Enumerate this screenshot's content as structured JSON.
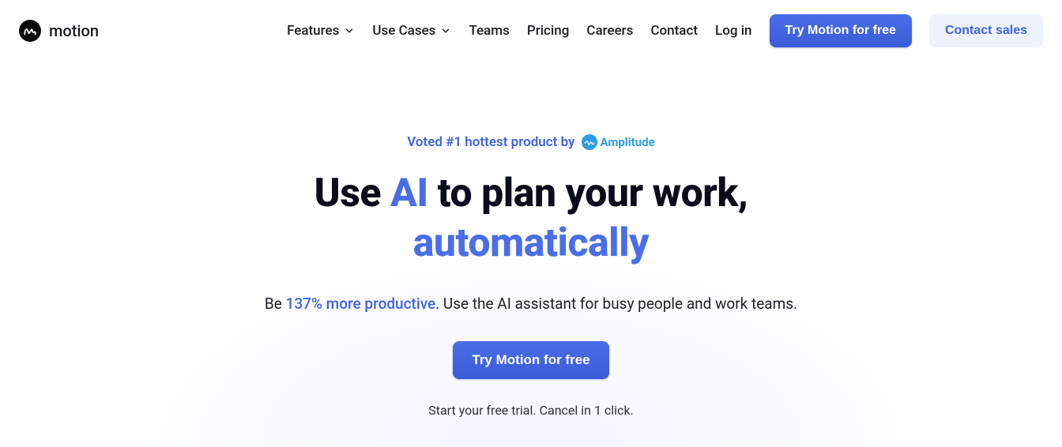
{
  "brand": {
    "name": "motion"
  },
  "nav": {
    "features": "Features",
    "use_cases": "Use Cases",
    "teams": "Teams",
    "pricing": "Pricing",
    "careers": "Careers",
    "contact": "Contact",
    "login": "Log in"
  },
  "cta": {
    "try_free": "Try Motion for free",
    "contact_sales": "Contact sales"
  },
  "hero": {
    "tagline": "Voted #1 hottest product by",
    "amplitude": "Amplitude",
    "headline_pre": "Use ",
    "headline_ai": "AI",
    "headline_mid": " to plan your work,",
    "headline_auto": "automatically",
    "sub_pre": "Be ",
    "sub_highlight": "137% more productive",
    "sub_post": ". Use the AI assistant for busy people and work teams.",
    "cta": "Try Motion for free",
    "microcopy": "Start your free trial. Cancel in 1 click."
  }
}
